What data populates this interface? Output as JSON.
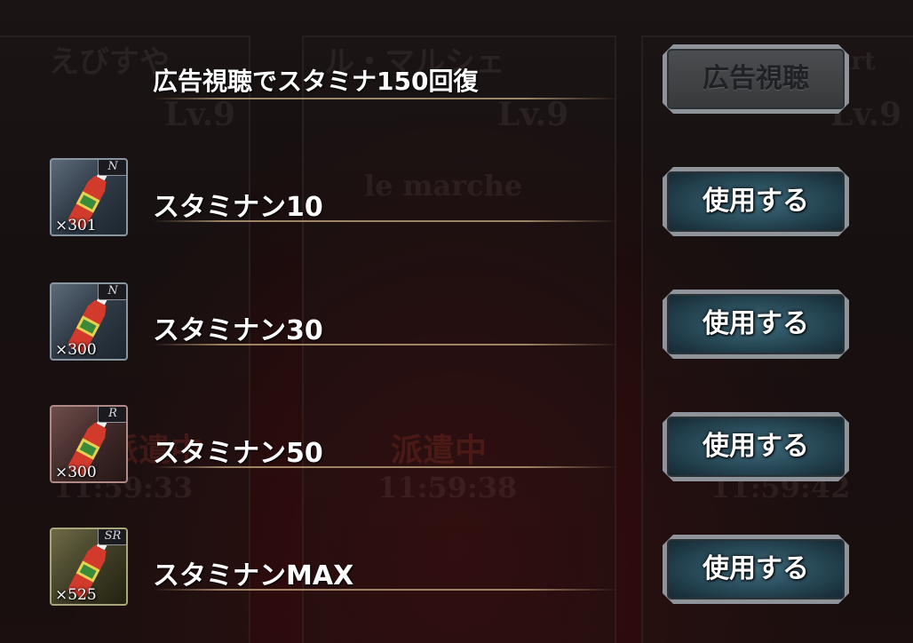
{
  "background": {
    "player_names": [
      "えびすや",
      "ル・マルシェ",
      "art"
    ],
    "levels": [
      "Lv.9",
      "Lv.9",
      "Lv.9"
    ],
    "shop_sign": "le marche",
    "dispatch_label": "派遣中",
    "timers": [
      "11:59:33",
      "11:59:38",
      "11:59:42"
    ]
  },
  "ad_row": {
    "label": "広告視聴でスタミナ150回復",
    "button_label": "広告視聴",
    "button_state": "disabled"
  },
  "items": [
    {
      "name": "スタミナン10",
      "rarity": "N",
      "quantity": "×301",
      "button_label": "使用する",
      "frame_color": "#8a95a2"
    },
    {
      "name": "スタミナン30",
      "rarity": "N",
      "quantity": "×300",
      "button_label": "使用する",
      "frame_color": "#8a95a2"
    },
    {
      "name": "スタミナン50",
      "rarity": "R",
      "quantity": "×300",
      "button_label": "使用する",
      "frame_color": "#b08a86"
    },
    {
      "name": "スタミナンMAX",
      "rarity": "SR",
      "quantity": "×525",
      "button_label": "使用する",
      "frame_color": "#a8a67c"
    }
  ],
  "colors": {
    "button_active": "#254553",
    "button_disabled": "#3f4143",
    "divider": "#c8aa82"
  }
}
